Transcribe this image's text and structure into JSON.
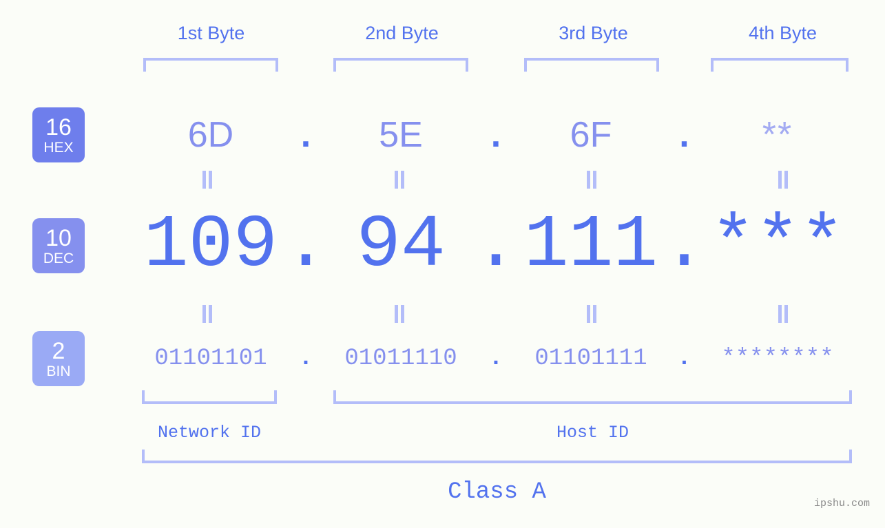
{
  "page": {
    "background_color": "#fbfdf8",
    "watermark": "ipshu.com"
  },
  "colors": {
    "accent_strong": "#5272ee",
    "accent_mid": "#8590ee",
    "accent_light": "#b3bdf9",
    "badge_hex": "#6e7eec",
    "badge_dec": "#8590ee",
    "badge_bin": "#9aaaf5",
    "watermark": "#8a8a8a"
  },
  "byte_headers": [
    {
      "label": "1st Byte"
    },
    {
      "label": "2nd Byte"
    },
    {
      "label": "3rd Byte"
    },
    {
      "label": "4th Byte"
    }
  ],
  "bases": [
    {
      "number": "16",
      "abbr": "HEX"
    },
    {
      "number": "10",
      "abbr": "DEC"
    },
    {
      "number": "2",
      "abbr": "BIN"
    }
  ],
  "separator": ".",
  "rows": {
    "hex": {
      "base_number": "16",
      "base_abbr": "HEX",
      "values": [
        "6D",
        "5E",
        "6F",
        "**"
      ],
      "masked": [
        false,
        false,
        false,
        true
      ]
    },
    "dec": {
      "base_number": "10",
      "base_abbr": "DEC",
      "values": [
        "109",
        "94",
        "111",
        "***"
      ],
      "masked": [
        false,
        false,
        false,
        true
      ]
    },
    "bin": {
      "base_number": "2",
      "base_abbr": "BIN",
      "values": [
        "01101101",
        "01011110",
        "01101111",
        "********"
      ],
      "masked": [
        false,
        false,
        false,
        true
      ]
    }
  },
  "connectors": {
    "glyph": "||",
    "name": "equals-connector"
  },
  "id_sections": [
    {
      "label": "Network ID"
    },
    {
      "label": "Host ID"
    }
  ],
  "class": {
    "label": "Class A"
  }
}
